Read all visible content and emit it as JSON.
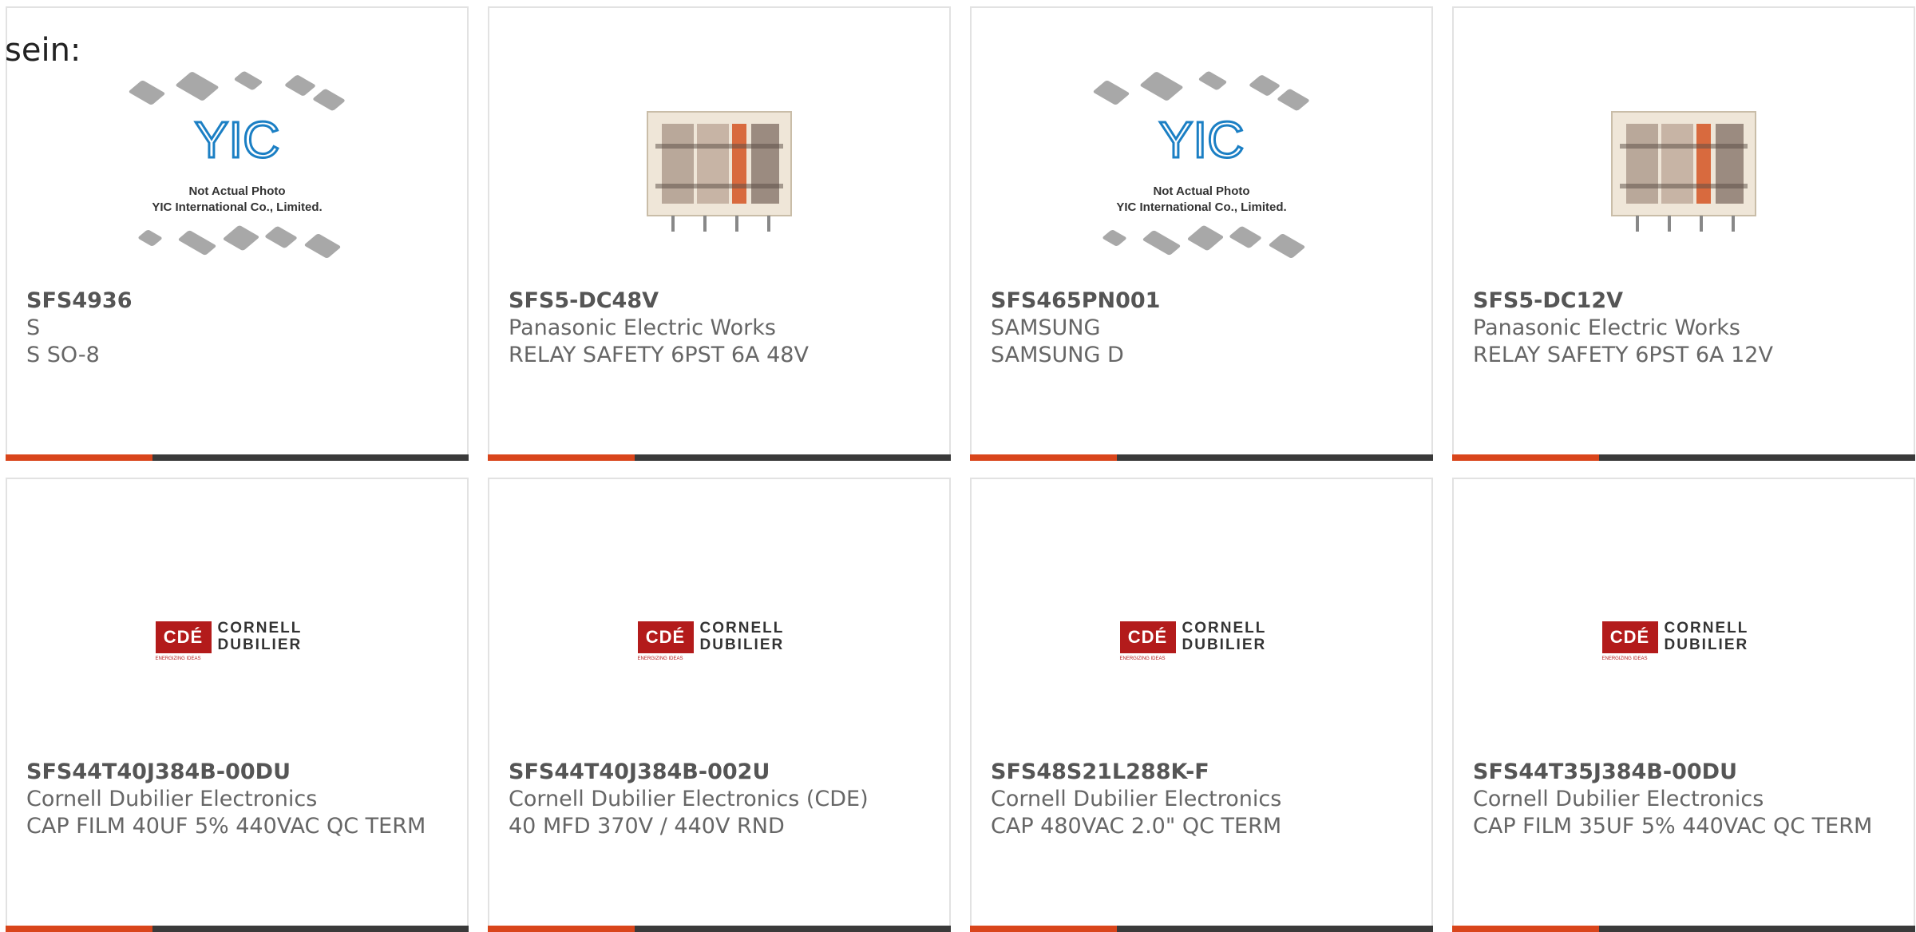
{
  "leading_text": "sein:",
  "placeholder": {
    "caption_line1": "Not Actual Photo",
    "caption_line2": "YIC International Co., Limited.",
    "logo_text": "YIC"
  },
  "cde_logo": {
    "mark": "CDÉ",
    "line1": "CORNELL",
    "line2": "DUBILIER",
    "tagline": "ENERGIZING IDEAS"
  },
  "colors": {
    "accent": "#d9451b",
    "bar": "#3a3a3a",
    "cde_red": "#b31b1b"
  },
  "products": [
    {
      "part": "SFS4936",
      "manufacturer": "S",
      "description": "S SO-8",
      "image": "yic-placeholder"
    },
    {
      "part": "SFS5-DC48V",
      "manufacturer": "Panasonic Electric Works",
      "description": "RELAY SAFETY 6PST 6A 48V",
      "image": "relay-photo"
    },
    {
      "part": "SFS465PN001",
      "manufacturer": "SAMSUNG",
      "description": "SAMSUNG D",
      "image": "yic-placeholder"
    },
    {
      "part": "SFS5-DC12V",
      "manufacturer": "Panasonic Electric Works",
      "description": "RELAY SAFETY 6PST 6A 12V",
      "image": "relay-photo"
    },
    {
      "part": "SFS44T40J384B-00DU",
      "manufacturer": "Cornell Dubilier Electronics",
      "description": "CAP FILM 40UF 5% 440VAC QC TERM",
      "image": "cde-logo"
    },
    {
      "part": "SFS44T40J384B-002U",
      "manufacturer": "Cornell Dubilier Electronics (CDE)",
      "description": "40 MFD 370V / 440V RND",
      "image": "cde-logo"
    },
    {
      "part": "SFS48S21L288K-F",
      "manufacturer": "Cornell Dubilier Electronics",
      "description": "CAP 480VAC 2.0\" QC TERM",
      "image": "cde-logo"
    },
    {
      "part": "SFS44T35J384B-00DU",
      "manufacturer": "Cornell Dubilier Electronics",
      "description": "CAP FILM 35UF 5% 440VAC QC TERM",
      "image": "cde-logo"
    }
  ]
}
